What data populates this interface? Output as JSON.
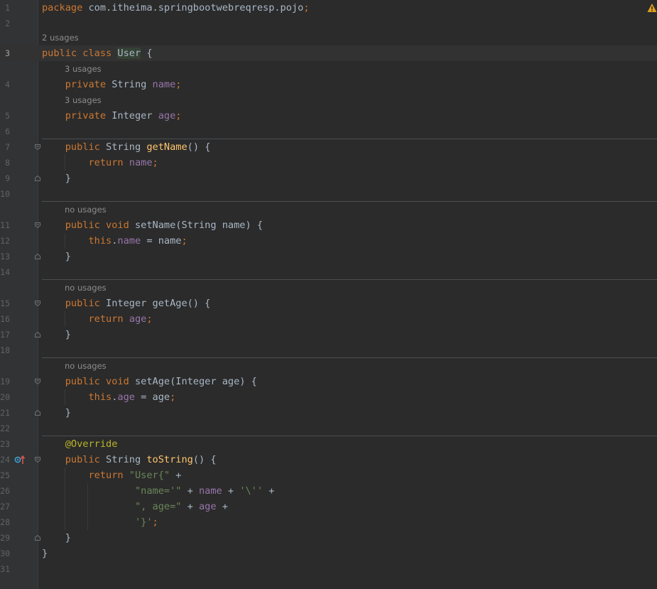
{
  "editor": {
    "hints": {
      "class_usages": "2 usages",
      "name_usages": "3 usages",
      "age_usages": "3 usages",
      "setName_usages": "no usages",
      "getAge_usages": "no usages",
      "setAge_usages": "no usages"
    },
    "lines": [
      {
        "n": "1",
        "tokens": [
          [
            "kw",
            "package "
          ],
          [
            "",
            "com.itheima.springbootwebreqresp.pojo"
          ],
          [
            "kw",
            ";"
          ]
        ]
      },
      {
        "n": "2",
        "tokens": []
      },
      {
        "n": "3",
        "tokens": [
          [
            "kw",
            "public class "
          ],
          [
            "cls-hl",
            "User"
          ],
          [
            "",
            " {"
          ]
        ]
      },
      {
        "n": "4",
        "tokens": [
          [
            "",
            "    "
          ],
          [
            "kw",
            "private "
          ],
          [
            "",
            "String "
          ],
          [
            "field",
            "name"
          ],
          [
            "kw",
            ";"
          ]
        ]
      },
      {
        "n": "5",
        "tokens": [
          [
            "",
            "    "
          ],
          [
            "kw",
            "private "
          ],
          [
            "",
            "Integer "
          ],
          [
            "field",
            "age"
          ],
          [
            "kw",
            ";"
          ]
        ]
      },
      {
        "n": "6",
        "tokens": []
      },
      {
        "n": "7",
        "tokens": [
          [
            "",
            "    "
          ],
          [
            "kw",
            "public "
          ],
          [
            "",
            "String "
          ],
          [
            "method",
            "getName"
          ],
          [
            "",
            "() {"
          ]
        ]
      },
      {
        "n": "8",
        "tokens": [
          [
            "",
            "        "
          ],
          [
            "kw",
            "return "
          ],
          [
            "field",
            "name"
          ],
          [
            "kw",
            ";"
          ]
        ]
      },
      {
        "n": "9",
        "tokens": [
          [
            "",
            "    }"
          ]
        ]
      },
      {
        "n": "10",
        "tokens": []
      },
      {
        "n": "11",
        "tokens": [
          [
            "",
            "    "
          ],
          [
            "kw",
            "public void "
          ],
          [
            "",
            "setName(String name) {"
          ]
        ]
      },
      {
        "n": "12",
        "tokens": [
          [
            "",
            "        "
          ],
          [
            "kw",
            "this"
          ],
          [
            "",
            "."
          ],
          [
            "field",
            "name"
          ],
          [
            "",
            " = name"
          ],
          [
            "kw",
            ";"
          ]
        ]
      },
      {
        "n": "13",
        "tokens": [
          [
            "",
            "    }"
          ]
        ]
      },
      {
        "n": "14",
        "tokens": []
      },
      {
        "n": "15",
        "tokens": [
          [
            "",
            "    "
          ],
          [
            "kw",
            "public "
          ],
          [
            "",
            "Integer getAge() {"
          ]
        ]
      },
      {
        "n": "16",
        "tokens": [
          [
            "",
            "        "
          ],
          [
            "kw",
            "return "
          ],
          [
            "field",
            "age"
          ],
          [
            "kw",
            ";"
          ]
        ]
      },
      {
        "n": "17",
        "tokens": [
          [
            "",
            "    }"
          ]
        ]
      },
      {
        "n": "18",
        "tokens": []
      },
      {
        "n": "19",
        "tokens": [
          [
            "",
            "    "
          ],
          [
            "kw",
            "public void "
          ],
          [
            "",
            "setAge(Integer age) {"
          ]
        ]
      },
      {
        "n": "20",
        "tokens": [
          [
            "",
            "        "
          ],
          [
            "kw",
            "this"
          ],
          [
            "",
            "."
          ],
          [
            "field",
            "age"
          ],
          [
            "",
            " = age"
          ],
          [
            "kw",
            ";"
          ]
        ]
      },
      {
        "n": "21",
        "tokens": [
          [
            "",
            "    }"
          ]
        ]
      },
      {
        "n": "22",
        "tokens": []
      },
      {
        "n": "23",
        "tokens": [
          [
            "",
            "    "
          ],
          [
            "ann",
            "@Override"
          ]
        ]
      },
      {
        "n": "24",
        "tokens": [
          [
            "",
            "    "
          ],
          [
            "kw",
            "public "
          ],
          [
            "",
            "String "
          ],
          [
            "method",
            "toString"
          ],
          [
            "",
            "() {"
          ]
        ]
      },
      {
        "n": "25",
        "tokens": [
          [
            "",
            "        "
          ],
          [
            "kw",
            "return "
          ],
          [
            "str",
            "\"User{\""
          ],
          [
            "",
            " +"
          ]
        ]
      },
      {
        "n": "26",
        "tokens": [
          [
            "",
            "                "
          ],
          [
            "str",
            "\"name='\""
          ],
          [
            "",
            " + "
          ],
          [
            "field",
            "name"
          ],
          [
            "",
            " + "
          ],
          [
            "str",
            "'\\''"
          ],
          [
            "",
            " +"
          ]
        ]
      },
      {
        "n": "27",
        "tokens": [
          [
            "",
            "                "
          ],
          [
            "str",
            "\", age=\""
          ],
          [
            "",
            " + "
          ],
          [
            "field",
            "age"
          ],
          [
            "",
            " +"
          ]
        ]
      },
      {
        "n": "28",
        "tokens": [
          [
            "",
            "                "
          ],
          [
            "str",
            "'}'"
          ],
          [
            "kw",
            ";"
          ]
        ]
      },
      {
        "n": "29",
        "tokens": [
          [
            "",
            "    }"
          ]
        ]
      },
      {
        "n": "30",
        "tokens": [
          [
            "",
            "}"
          ]
        ]
      },
      {
        "n": "31",
        "tokens": []
      }
    ]
  },
  "colors": {
    "background": "#2b2b2b",
    "gutter": "#313335",
    "keyword": "#cc7832",
    "field": "#9876aa",
    "method": "#ffc66d",
    "string": "#6a8759",
    "annotation": "#bbb529",
    "warning": "#e0a31e"
  },
  "icons": {
    "warning": "warning-icon",
    "override": "override-implements-icon",
    "fold": "fold-marker-icon"
  }
}
